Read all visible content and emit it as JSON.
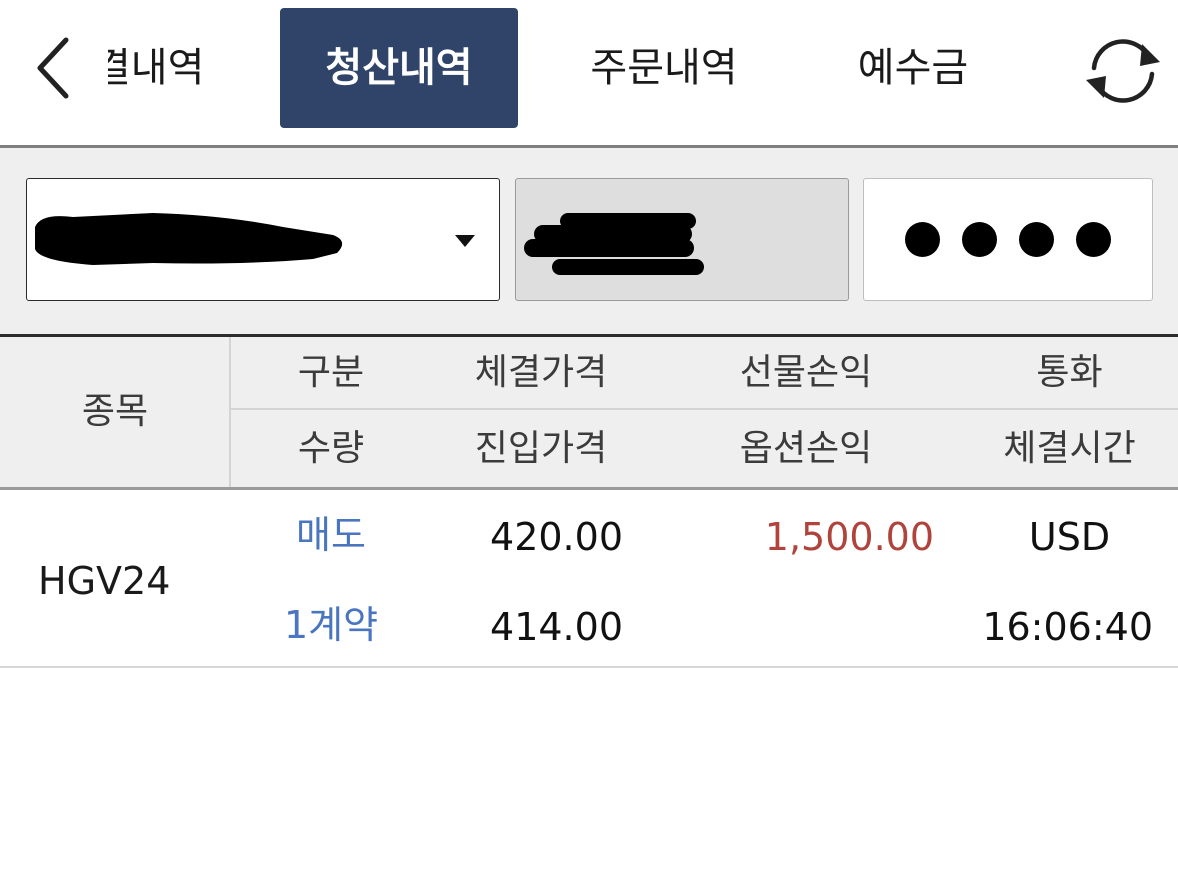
{
  "tabs": {
    "partial_label": "결내역",
    "active_label": "청산내역",
    "orders_label": "주문내역",
    "deposit_label": "예수금"
  },
  "account": {
    "password_dots": "●●●●"
  },
  "table": {
    "headers": {
      "stock": "종목",
      "row1": [
        "구분",
        "체결가격",
        "선물손익",
        "통화"
      ],
      "row2": [
        "수량",
        "진입가격",
        "옵션손익",
        "체결시간"
      ]
    },
    "rows": [
      {
        "stock": "HGV24",
        "side": "매도",
        "qty": "1계약",
        "fill_price": "420.00",
        "entry_price": "414.00",
        "futures_pnl": "1,500.00",
        "options_pnl": "",
        "currency": "USD",
        "fill_time": "16:06:40"
      }
    ]
  },
  "colors": {
    "active_tab_bg": "#2f4468",
    "side_blue": "#4a76c0",
    "profit_red": "#b0443d"
  },
  "icons": [
    "back-chevron-icon",
    "refresh-icon",
    "dropdown-caret-icon"
  ]
}
